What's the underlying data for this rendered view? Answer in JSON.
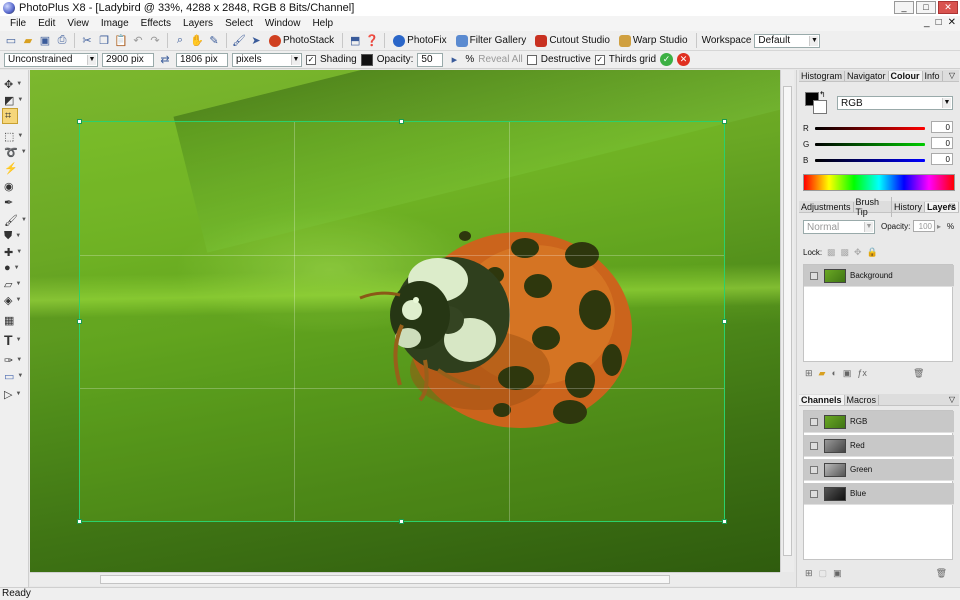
{
  "window": {
    "title": "PhotoPlus X8 - [Ladybird @ 33%, 4288 x 2848, RGB 8 Bits/Channel]",
    "minimize": "_",
    "maximize": "□",
    "close": "✕"
  },
  "menu": [
    "File",
    "Edit",
    "View",
    "Image",
    "Effects",
    "Layers",
    "Select",
    "Window",
    "Help"
  ],
  "mdi_controls": [
    "_",
    "□",
    "✕"
  ],
  "toolbar": {
    "photostack": "PhotoStack",
    "photofix": "PhotoFix",
    "filter_gallery": "Filter Gallery",
    "cutout_studio": "Cutout Studio",
    "warp_studio": "Warp Studio",
    "workspace_label": "Workspace",
    "workspace_value": "Default"
  },
  "options": {
    "mode": "Unconstrained",
    "width": "2900 pix",
    "height": "1806 pix",
    "units": "pixels",
    "shading_label": "Shading",
    "opacity_label": "Opacity:",
    "opacity_value": "50",
    "opacity_unit": "%",
    "reveal_all": "Reveal All",
    "destructive": "Destructive",
    "thirds_grid": "Thirds grid",
    "shading_checked": "✓",
    "thirds_checked": "✓"
  },
  "colour_panel": {
    "tabs": [
      "Histogram",
      "Navigator",
      "Colour",
      "Info"
    ],
    "active": "Colour",
    "mode": "RGB",
    "r_label": "R",
    "g_label": "G",
    "b_label": "B",
    "r": "0",
    "g": "0",
    "b": "0"
  },
  "layers_panel": {
    "tabs": [
      "Adjustments",
      "Brush Tip",
      "History",
      "Layers"
    ],
    "active": "Layers",
    "blend": "Normal",
    "opacity_label": "Opacity:",
    "opacity": "100",
    "opacity_unit": "%",
    "lock_label": "Lock:",
    "layers": [
      "Background"
    ]
  },
  "channels_panel": {
    "tabs": [
      "Channels",
      "Macros"
    ],
    "active": "Channels",
    "channels": [
      "RGB",
      "Red",
      "Green",
      "Blue"
    ]
  },
  "status": "Ready",
  "colors": {
    "crop_border": "#2bd16b",
    "ladybird_red": "#e0541c",
    "accent": "#f6d67a"
  }
}
